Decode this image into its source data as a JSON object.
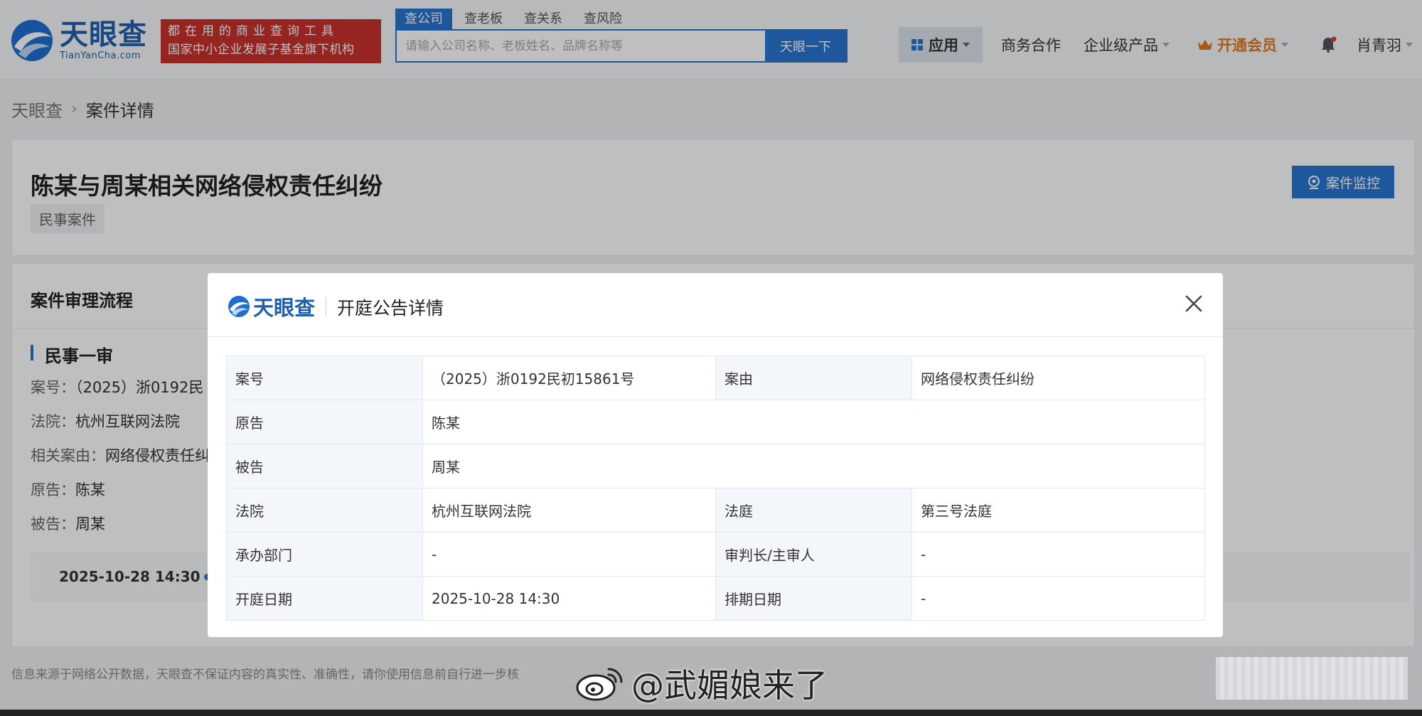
{
  "header": {
    "logo": {
      "cn": "天眼查",
      "en": "TianYanCha.com"
    },
    "slogan": {
      "line1": "都在用的商业查询工具",
      "line2": "国家中小企业发展子基金旗下机构"
    },
    "search_tabs": [
      "查公司",
      "查老板",
      "查关系",
      "查风险"
    ],
    "search_placeholder": "请输入公司名称、老板姓名、品牌名称等",
    "search_button": "天眼一下",
    "nav": {
      "apps": "应用",
      "business": "商务合作",
      "enterprise": "企业级产品",
      "vip": "开通会员",
      "user": "肖青羽"
    }
  },
  "breadcrumb": {
    "home": "天眼查",
    "current": "案件详情"
  },
  "case": {
    "title": "陈某与周某相关网络侵权责任纠纷",
    "tag": "民事案件",
    "monitor_button": "案件监控"
  },
  "flow": {
    "heading": "案件审理流程",
    "stage": "民事一审",
    "lines": [
      {
        "label": "案号：",
        "value": "（2025）浙0192民"
      },
      {
        "label": "法院：",
        "value": "杭州互联网法院"
      },
      {
        "label": "相关案由：",
        "value": "网络侵权责任纠"
      },
      {
        "label": "原告：",
        "value": "陈某"
      },
      {
        "label": "被告：",
        "value": "周某"
      }
    ],
    "timeline_date": "2025-10-28 14:30"
  },
  "footer_note": "信息来源于网络公开数据，天眼查不保证内容的真实性、准确性，请你使用信息前自行进一步核",
  "modal": {
    "logo": "天眼查",
    "title": "开庭公告详情",
    "rows": [
      {
        "l1": "案号",
        "v1": "（2025）浙0192民初15861号",
        "l2": "案由",
        "v2": "网络侵权责任纠纷"
      },
      {
        "l1": "原告",
        "v1": "陈某"
      },
      {
        "l1": "被告",
        "v1": "周某"
      },
      {
        "l1": "法院",
        "v1": "杭州互联网法院",
        "l2": "法庭",
        "v2": "第三号法庭"
      },
      {
        "l1": "承办部门",
        "v1": "-",
        "l2": "审判长/主审人",
        "v2": "-"
      },
      {
        "l1": "开庭日期",
        "v1": "2025-10-28 14:30",
        "l2": "排期日期",
        "v2": "-"
      }
    ]
  },
  "watermark": "@武媚娘来了",
  "colors": {
    "brand": "#2a75d0",
    "logo": "#1f5fb0",
    "slogan_bg": "#c9302c",
    "vip": "#e07a1f"
  }
}
